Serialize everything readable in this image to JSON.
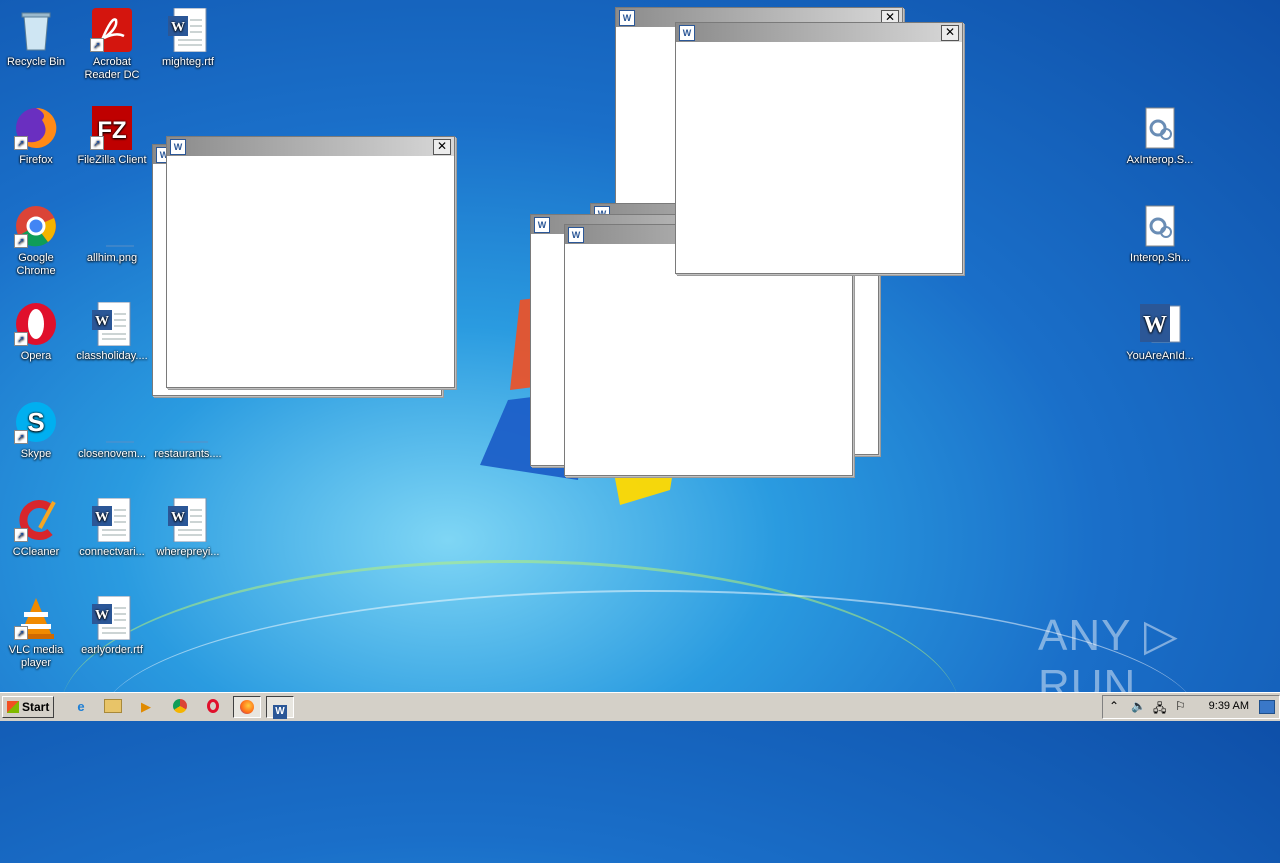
{
  "desktop_icons": {
    "recycle_bin": "Recycle Bin",
    "acrobat": "Acrobat\nReader DC",
    "mighteg": "mighteg.rtf",
    "firefox": "Firefox",
    "filezilla": "FileZilla Client",
    "chrome": "Google\nChrome",
    "allhim": "allhim.png",
    "opera": "Opera",
    "classholiday": "classholiday....",
    "skype": "Skype",
    "closenovem": "closenovem...",
    "restaurants": "restaurants....",
    "ccleaner": "CCleaner",
    "connectvari": "connectvari...",
    "whereprevi": "wherepreyi...",
    "vlc": "VLC media\nplayer",
    "earlyorder": "earlyorder.rtf",
    "axinterop": "AxInterop.S...",
    "interop": "Interop.Sh...",
    "youareanid": "YouAreAnId..."
  },
  "windows": {
    "close_glyph": "✕",
    "doc_glyph": "W"
  },
  "taskbar": {
    "start_label": "Start",
    "clock": "9:39 AM"
  },
  "watermark": "ANY ▷ RUN"
}
